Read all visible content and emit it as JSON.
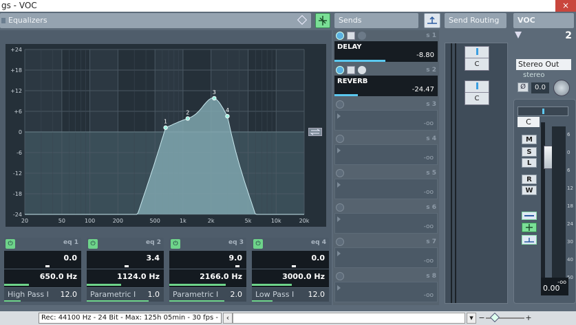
{
  "window": {
    "title": "gs - VOC",
    "close": "×"
  },
  "equalizers": {
    "label": "Equalizers"
  },
  "sends": {
    "label": "Sends"
  },
  "send_routing": {
    "label": "Send Routing"
  },
  "channel": {
    "name": "VOC",
    "number": "2",
    "output": "Stereo Out",
    "format": "stereo",
    "pan": "0.0",
    "pan_label": "C",
    "volume": "0.00",
    "meter_top": "-oo"
  },
  "graph": {
    "y_ticks": [
      "+24",
      "+18",
      "+12",
      "+6",
      "0",
      "-6",
      "-12",
      "-18",
      "-24"
    ],
    "x_ticks": [
      "20",
      "50",
      "100",
      "200",
      "500",
      "1k",
      "2k",
      "5k",
      "10k",
      "20k"
    ],
    "points": [
      {
        "label": "1"
      },
      {
        "label": "2"
      },
      {
        "label": "3"
      },
      {
        "label": "4"
      }
    ]
  },
  "eq": [
    {
      "label": "eq 1",
      "gain": "0.0",
      "freq": "650.0 Hz",
      "type": "High Pass I",
      "q": "12.0"
    },
    {
      "label": "eq 2",
      "gain": "3.4",
      "freq": "1124.0 Hz",
      "type": "Parametric I",
      "q": "1.0"
    },
    {
      "label": "eq 3",
      "gain": "9.0",
      "freq": "2166.0 Hz",
      "type": "Parametric I",
      "q": "2.0"
    },
    {
      "label": "eq 4",
      "gain": "0.0",
      "freq": "3000.0 Hz",
      "type": "Low Pass I",
      "q": "12.0"
    }
  ],
  "send_slots": [
    {
      "num": "s 1",
      "name": "DELAY",
      "value": "-8.80",
      "active": true
    },
    {
      "num": "s 2",
      "name": "REVERB",
      "value": "-24.47",
      "active": true
    },
    {
      "num": "s 3",
      "name": "",
      "value": "-oo",
      "active": false
    },
    {
      "num": "s 4",
      "name": "",
      "value": "-oo",
      "active": false
    },
    {
      "num": "s 5",
      "name": "",
      "value": "-oo",
      "active": false
    },
    {
      "num": "s 6",
      "name": "",
      "value": "-oo",
      "active": false
    },
    {
      "num": "s 7",
      "name": "",
      "value": "-oo",
      "active": false
    },
    {
      "num": "s 8",
      "name": "",
      "value": "-oo",
      "active": false
    }
  ],
  "routing": [
    {
      "pan": "C"
    },
    {
      "pan": "C"
    }
  ],
  "strip_buttons": [
    "M",
    "S",
    "L",
    "R",
    "W"
  ],
  "fader_scale": [
    "6",
    "0",
    "6",
    "12",
    "18",
    "24",
    "30",
    "40",
    "50"
  ],
  "status": {
    "text": "Rec: 44100 Hz - 24 Bit - Max: 125h 05min - 30 fps - Pa"
  },
  "colors": {
    "eq_curve_fill": "#7fa6ae",
    "green_button": "#7adf96"
  }
}
